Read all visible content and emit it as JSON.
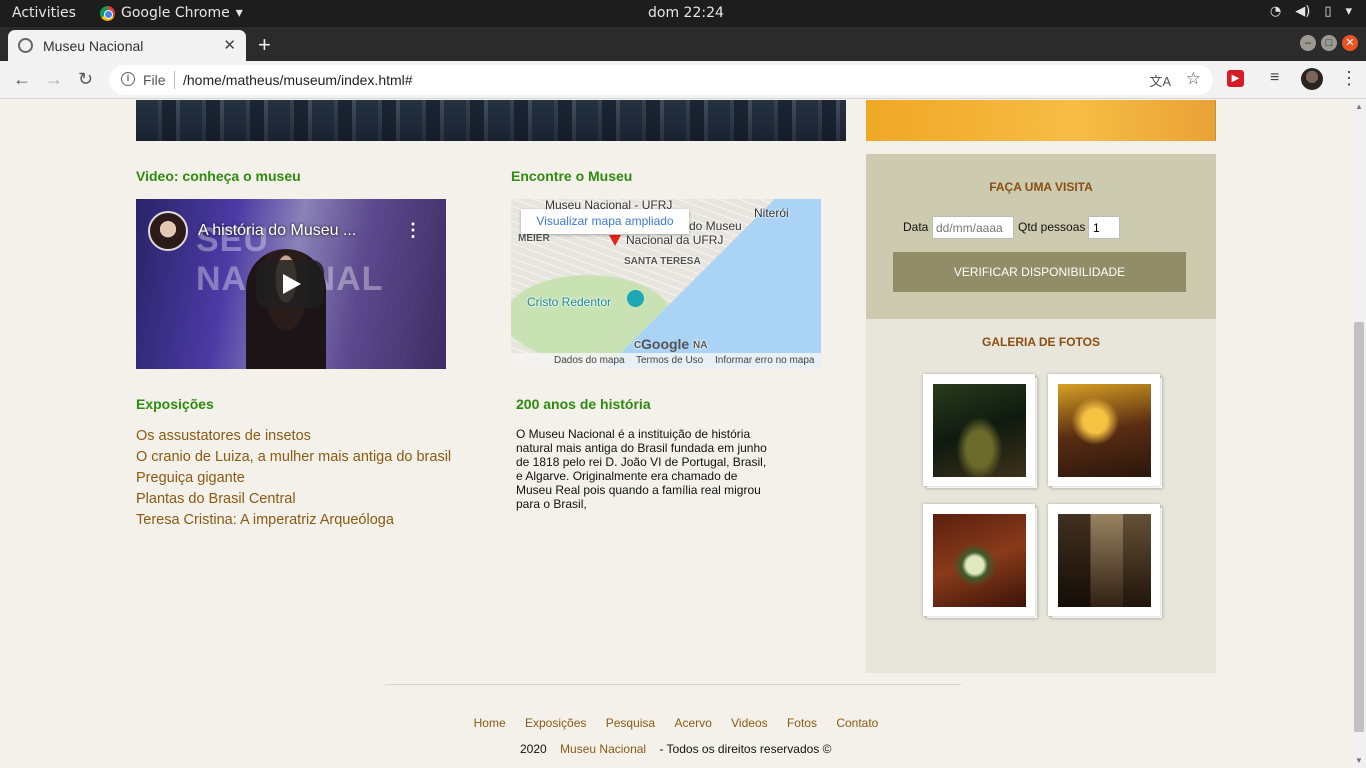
{
  "os": {
    "activities": "Activities",
    "app_name": "Google Chrome",
    "clock": "dom 22:24"
  },
  "browser": {
    "tab_title": "Museu Nacional",
    "file_label": "File",
    "url": "/home/matheus/museum/index.html#"
  },
  "main": {
    "video_section_title": "Video: conheça o museu",
    "video": {
      "title": "A história do Museu ...",
      "background_text": "SEU NACIONAL"
    },
    "map_section_title": "Encontre o Museu",
    "map": {
      "view_larger": "Visualizar mapa ampliado",
      "labels": {
        "museum_1": "Museu Nacional - UFRJ",
        "museum_2": "do Museu",
        "museum_3": "Nacional da UFRJ",
        "niteroi": "Niterói",
        "meier": "MEIER",
        "santa_teresa": "SANTA TERESA",
        "cristo": "Cristo Redentor",
        "copacabana": "C",
        "na": "NA"
      },
      "google": "Google",
      "footer": {
        "map_data": "Dados do mapa",
        "terms": "Termos de Uso",
        "report": "Informar erro no mapa"
      }
    },
    "expo_section_title": "Exposições",
    "expositions": [
      "Os assustatores de insetos",
      "O cranio de Luiza, a mulher mais antiga do brasil",
      "Preguiça gigante",
      "Plantas do Brasil Central",
      "Teresa Cristina: A imperatriz Arqueóloga"
    ],
    "history_section_title": "200 anos de história",
    "history_text": "O Museu Nacional é a instituição de história natural mais antiga do Brasil fundada em junho de 1818 pelo rei D. João VI de Portugal, Brasil, e Algarve. Originalmente era chamado de Museu Real pois quando a família real migrou para o Brasil,"
  },
  "sidebar": {
    "visit_title": "FAÇA UMA VISITA",
    "date_label": "Data",
    "date_placeholder": "dd/mm/aaaa",
    "qty_label": "Qtd pessoas",
    "qty_value": "1",
    "verify_button": "VERIFICAR DISPONIBILIDADE",
    "gallery_title": "GALERIA DE FOTOS"
  },
  "footer": {
    "nav": [
      "Home",
      "Exposições",
      "Pesquisa",
      "Acervo",
      "Videos",
      "Fotos",
      "Contato"
    ],
    "year": "2020",
    "brand": "Museu Nacional",
    "rights": "- Todos os direitos reservados ©"
  },
  "colors": {
    "section_title": "#2e8b10",
    "link": "#8b5a14",
    "visit_panel": "#cccaaf",
    "verify_button": "#918e67"
  }
}
